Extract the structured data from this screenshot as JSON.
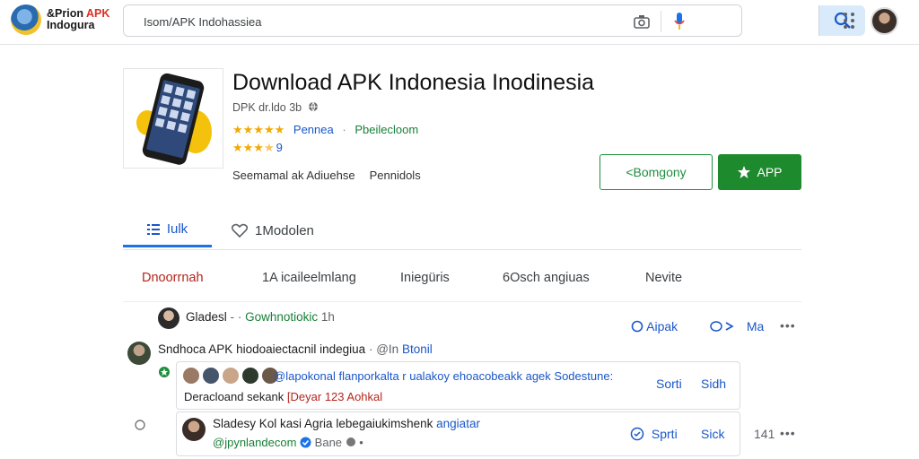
{
  "header": {
    "logo_line1": "&Prion",
    "logo_line1_accent": "APK",
    "logo_line2": "Indogura",
    "search_value": "Isom/APK Indohassiea",
    "search_placeholder": "",
    "icons": [
      "camera-icon",
      "mic-icon",
      "search-icon",
      "apps-grid-icon"
    ]
  },
  "app": {
    "title": "Download APK Indonesia Inodinesia",
    "meta": "DPK dr.ldo 3b",
    "stars_full": "★★★★★",
    "rating_link": "Pennea",
    "dot": "·",
    "category": "Pbeilecloom",
    "stars_partial": "★★★",
    "stars_partial_count": "★",
    "stars_partial_label": "9",
    "developer": "Seemamal ak Adiuehse",
    "size_label": "Pennidols",
    "btn_outline": "Bomgony",
    "btn_solid": "APP"
  },
  "tabs": [
    {
      "label": "Iulk"
    },
    {
      "label": "1Modolen"
    }
  ],
  "subtabs": [
    {
      "label": "Dnoorrnah"
    },
    {
      "label": "1A icaileelmlang"
    },
    {
      "label": "Iniegüris"
    },
    {
      "label": "6Osch angiuas"
    },
    {
      "label": "Nevite"
    }
  ],
  "comments": {
    "c1": {
      "author": "Gladesl",
      "sep": "-",
      "dot": "·",
      "tag": "Gowhnotiokic",
      "time": "1h",
      "act1": "Aipak",
      "act2": "Ma"
    },
    "c2": {
      "text": "Sndhoca APK hiodoaiectacnil indegiua",
      "dot": "·",
      "mention": "@In",
      "tag": "Btonil"
    },
    "c3": {
      "line1": "@lapokonal flanporkalta r ualakoy ehoacobeakk agek Sodestune:",
      "line2_a": "Deracloand sekank",
      "line2_b": "[Deyar 123 Aohkal",
      "act1": "Sorti",
      "act2": "Sidh"
    },
    "c4": {
      "author": "Sladesy Kol kasi Agria lebegaiukimshenk",
      "tag": "angiatar",
      "handle": "@jpynlandecom",
      "sub": "Bane",
      "act1": "Sprti",
      "act2": "Sick",
      "count": "141"
    }
  },
  "colors": {
    "accent_blue": "#1a57c9",
    "accent_green": "#1e8a2e",
    "star": "#f2a900",
    "red": "#b3261e"
  }
}
